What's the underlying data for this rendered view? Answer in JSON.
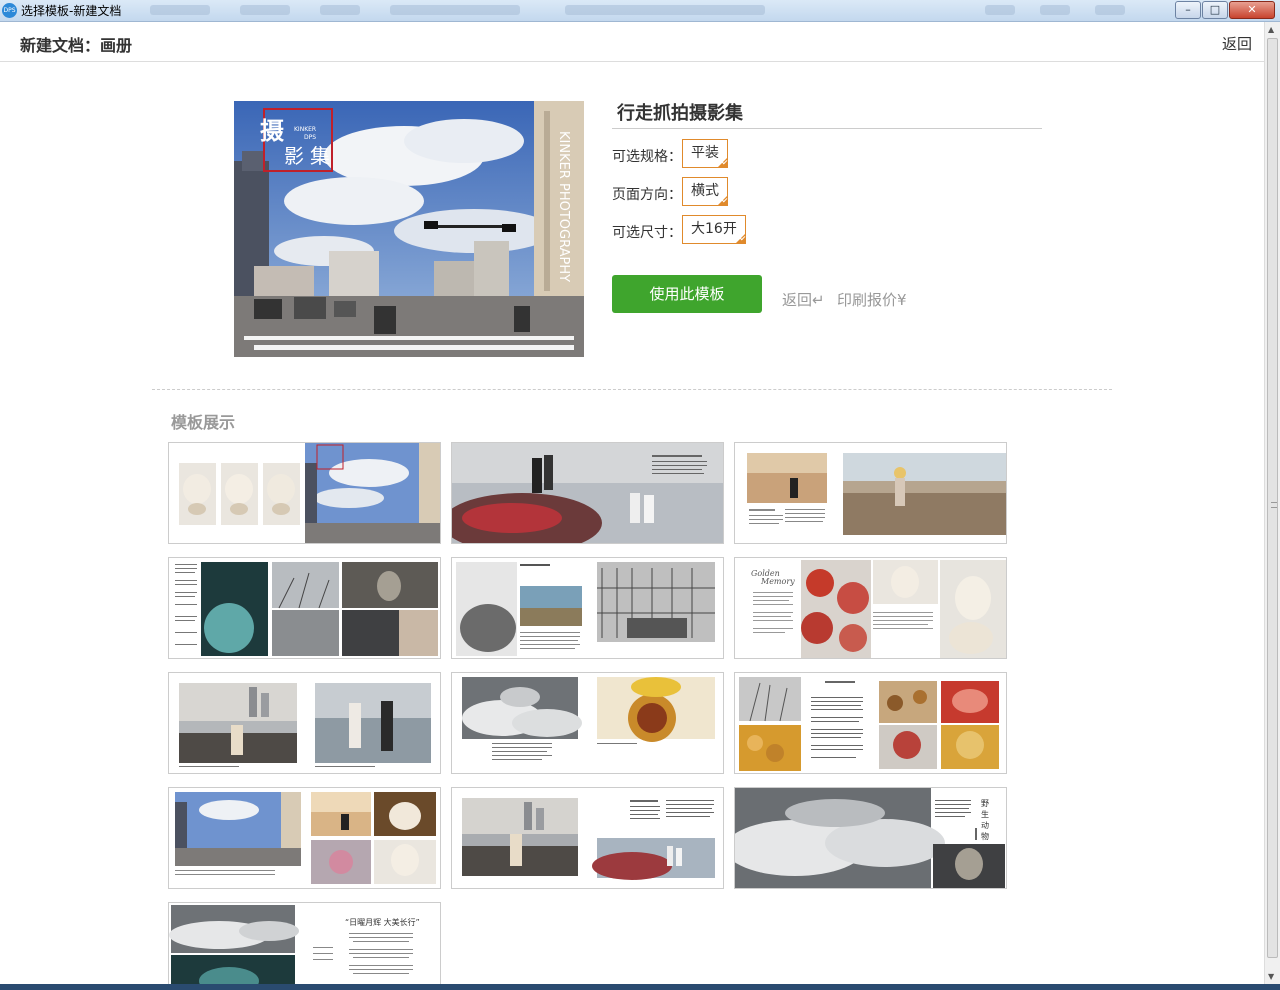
{
  "window": {
    "title": "选择模板-新建文档",
    "app_icon": "DPS",
    "controls": {
      "minimize": "–",
      "maximize": "□",
      "close": "✕"
    }
  },
  "header": {
    "title": "新建文档：画册",
    "back_label": "返回"
  },
  "product": {
    "title": "行走抓拍摄影集",
    "cover_text": {
      "calligraphy": "摄 影 集",
      "brand": "KINKER",
      "brand2": "DPS",
      "vertical": "KINKER PHOTOGRAPHY"
    },
    "options": [
      {
        "label": "可选规格：",
        "value": "平装"
      },
      {
        "label": "页面方向：",
        "value": "横式"
      },
      {
        "label": "可选尺寸：",
        "value": "大16开"
      }
    ],
    "use_button": "使用此模板",
    "back_link": "返回↵",
    "price_link": "印刷报价¥"
  },
  "gallery": {
    "title": "模板展示",
    "thumbnails": [
      "dogs-and-cover",
      "couple-flowers",
      "seaside-child",
      "dark-art-spread",
      "hat-and-sculpture",
      "golden-memory-food",
      "city-portrait-bay",
      "clouds-and-tea",
      "branches-and-dishes",
      "city-and-dog",
      "seaside-and-flowers",
      "clouds-and-vase",
      "quote-spread"
    ],
    "quote_text": "“日曜月辉 大美长行”"
  },
  "colors": {
    "accent_green": "#3fa52d",
    "option_border": "#e08a2c",
    "title_bar": "#c3d8ee"
  }
}
